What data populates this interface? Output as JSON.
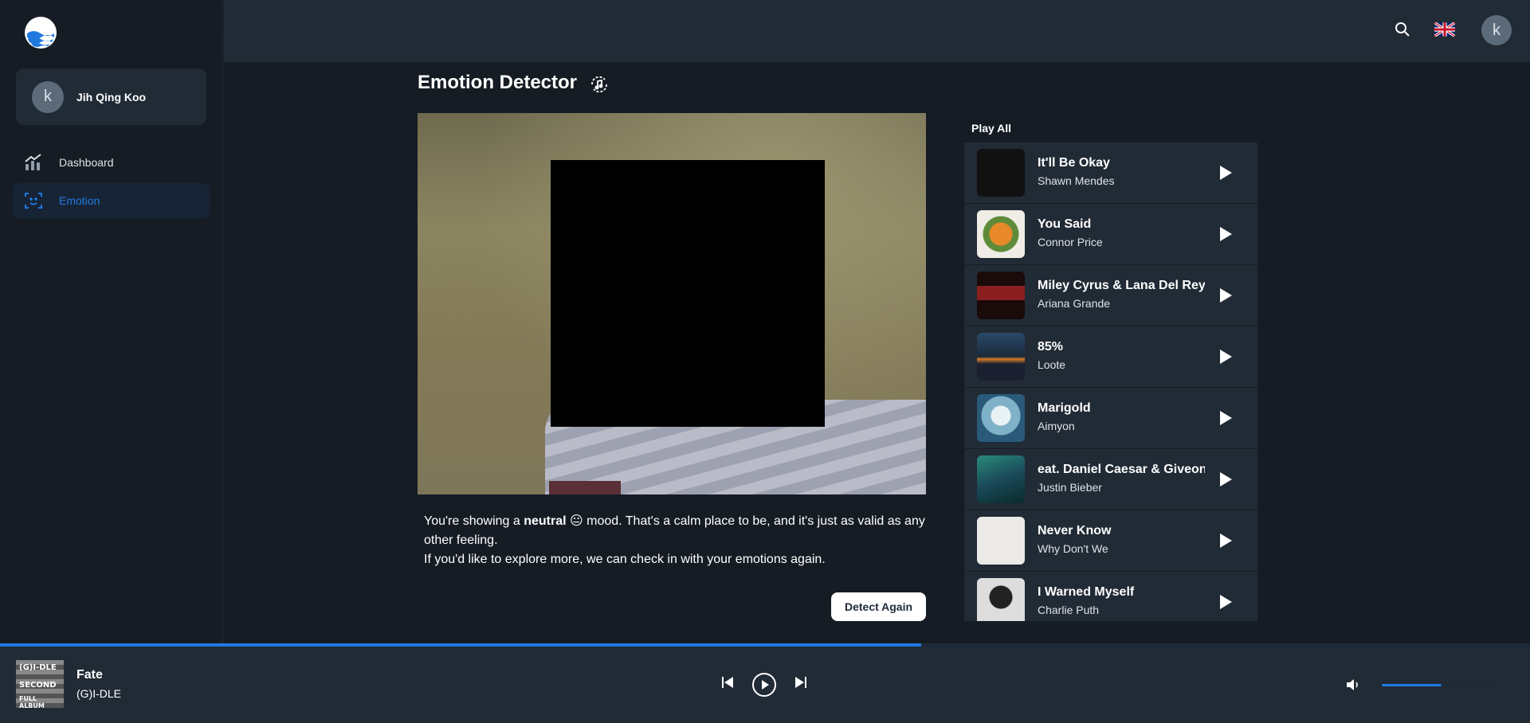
{
  "user": {
    "initial": "k",
    "name": "Jih Qing Koo"
  },
  "nav": {
    "items": [
      {
        "label": "Dashboard",
        "icon": "chart-icon",
        "active": false
      },
      {
        "label": "Emotion",
        "icon": "face-scan-icon",
        "active": true
      }
    ]
  },
  "topbar": {
    "avatar_initial": "k",
    "language": "English (UK)"
  },
  "page": {
    "title": "Emotion Detector"
  },
  "mood": {
    "prefix": "You're showing a ",
    "emotion": "neutral",
    "emoji": "😐",
    "line1_suffix": " mood. That's a calm place to be, and it's just as valid as any other feeling.",
    "line2": "If you'd like to explore more, we can check in with your emotions again."
  },
  "detect_button": "Detect Again",
  "playlist": {
    "play_all_label": "Play All",
    "tracks": [
      {
        "title": "It'll Be Okay",
        "artist": "Shawn Mendes"
      },
      {
        "title": "You Said",
        "artist": "Connor Price"
      },
      {
        "title": "Miley Cyrus & Lana Del Rey)",
        "artist": "Ariana Grande"
      },
      {
        "title": "85%",
        "artist": "Loote"
      },
      {
        "title": "Marigold",
        "artist": "Aimyon"
      },
      {
        "title": "eat. Daniel Caesar & Giveon)",
        "artist": "Justin Bieber"
      },
      {
        "title": "Never Know",
        "artist": "Why Don't We"
      },
      {
        "title": "I Warned Myself",
        "artist": "Charlie Puth"
      }
    ]
  },
  "player": {
    "title": "Fate",
    "artist": "(G)I-DLE",
    "cover_text": [
      "(G)I-DLE",
      "SECOND",
      "FULL ALBUM"
    ],
    "progress": 0.602,
    "volume": 0.5
  },
  "colors": {
    "accent": "#1f7ae0",
    "panel": "#212b36",
    "background": "#161c24"
  }
}
